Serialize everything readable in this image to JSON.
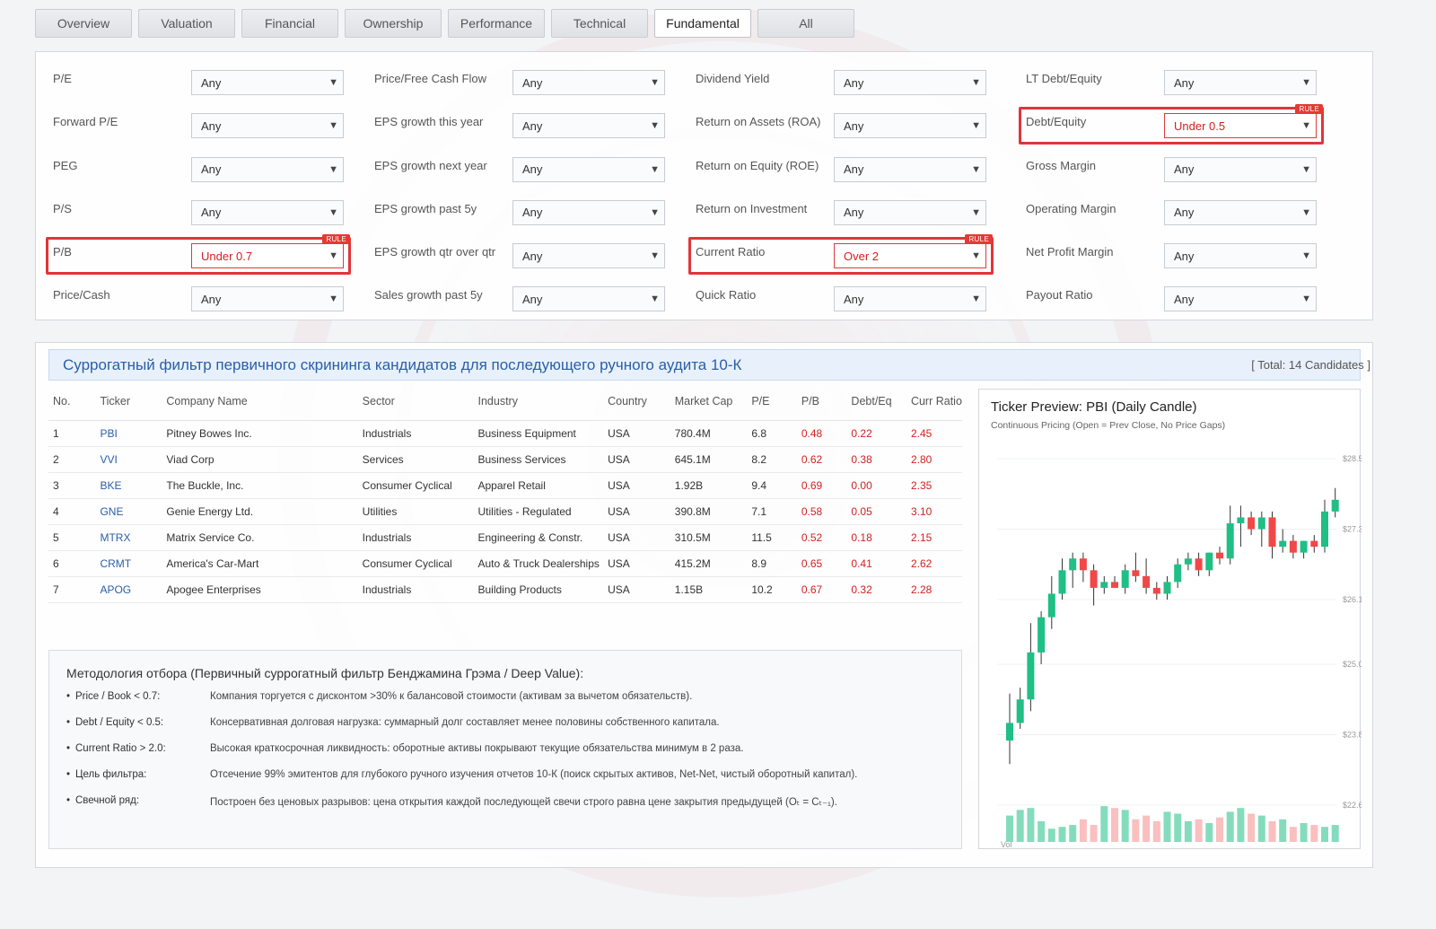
{
  "tabs": [
    "Overview",
    "Valuation",
    "Financial",
    "Ownership",
    "Performance",
    "Technical",
    "Fundamental",
    "All"
  ],
  "active_tab": "Fundamental",
  "filters": {
    "rule_badge": "RULE",
    "columns": [
      [
        {
          "label": "P/E",
          "value": "Any"
        },
        {
          "label": "Forward P/E",
          "value": "Any"
        },
        {
          "label": "PEG",
          "value": "Any"
        },
        {
          "label": "P/S",
          "value": "Any"
        },
        {
          "label": "P/B",
          "value": "Under 0.7",
          "rule": true
        },
        {
          "label": "Price/Cash",
          "value": "Any"
        }
      ],
      [
        {
          "label": "Price/Free Cash Flow",
          "value": "Any"
        },
        {
          "label": "EPS growth this year",
          "value": "Any"
        },
        {
          "label": "EPS growth next year",
          "value": "Any"
        },
        {
          "label": "EPS growth past 5y",
          "value": "Any"
        },
        {
          "label": "EPS growth qtr over qtr",
          "value": "Any"
        },
        {
          "label": "Sales growth past 5y",
          "value": "Any"
        }
      ],
      [
        {
          "label": "Dividend Yield",
          "value": "Any"
        },
        {
          "label": "Return on Assets (ROA)",
          "value": "Any"
        },
        {
          "label": "Return on Equity (ROE)",
          "value": "Any"
        },
        {
          "label": "Return on Investment",
          "value": "Any"
        },
        {
          "label": "Current Ratio",
          "value": "Over 2",
          "rule": true
        },
        {
          "label": "Quick Ratio",
          "value": "Any"
        }
      ],
      [
        {
          "label": "LT Debt/Equity",
          "value": "Any"
        },
        {
          "label": "Debt/Equity",
          "value": "Under 0.5",
          "rule": true
        },
        {
          "label": "Gross Margin",
          "value": "Any"
        },
        {
          "label": "Operating Margin",
          "value": "Any"
        },
        {
          "label": "Net Profit Margin",
          "value": "Any"
        },
        {
          "label": "Payout Ratio",
          "value": "Any"
        }
      ]
    ]
  },
  "results": {
    "title": "Суррогатный фильтр первичного скрининга кандидатов для последующего ручного аудита 10-К",
    "total": "[ Total: 14 Candidates ]",
    "columns": [
      "No.",
      "Ticker",
      "Company Name",
      "Sector",
      "Industry",
      "Country",
      "Market Cap",
      "P/E",
      "P/B",
      "Debt/Eq",
      "Curr Ratio"
    ],
    "rows": [
      [
        "1",
        "PBI",
        "Pitney Bowes Inc.",
        "Industrials",
        "Business Equipment",
        "USA",
        "780.4M",
        "6.8",
        "0.48",
        "0.22",
        "2.45"
      ],
      [
        "2",
        "VVI",
        "Viad Corp",
        "Services",
        "Business Services",
        "USA",
        "645.1M",
        "8.2",
        "0.62",
        "0.38",
        "2.80"
      ],
      [
        "3",
        "BKE",
        "The Buckle, Inc.",
        "Consumer Cyclical",
        "Apparel Retail",
        "USA",
        "1.92B",
        "9.4",
        "0.69",
        "0.00",
        "2.35"
      ],
      [
        "4",
        "GNE",
        "Genie Energy Ltd.",
        "Utilities",
        "Utilities - Regulated",
        "USA",
        "390.8M",
        "7.1",
        "0.58",
        "0.05",
        "3.10"
      ],
      [
        "5",
        "MTRX",
        "Matrix Service Co.",
        "Industrials",
        "Engineering & Constr.",
        "USA",
        "310.5M",
        "11.5",
        "0.52",
        "0.18",
        "2.15"
      ],
      [
        "6",
        "CRMT",
        "America's Car-Mart",
        "Consumer Cyclical",
        "Auto & Truck Dealerships",
        "USA",
        "415.2M",
        "8.9",
        "0.65",
        "0.41",
        "2.62"
      ],
      [
        "7",
        "APOG",
        "Apogee Enterprises",
        "Industrials",
        "Building Products",
        "USA",
        "1.15B",
        "10.2",
        "0.67",
        "0.32",
        "2.28"
      ]
    ]
  },
  "methodology": {
    "title": "Методология отбора (Первичный суррогатный фильтр Бенджамина Грэма / Deep Value):",
    "bullet": "•",
    "items": [
      {
        "key": "Price / Book < 0.7:",
        "text": "Компания торгуется с дисконтом >30% к балансовой стоимости (активам за вычетом обязательств)."
      },
      {
        "key": "Debt / Equity < 0.5:",
        "text": "Консервативная долговая нагрузка: суммарный долг составляет менее половины собственного капитала."
      },
      {
        "key": "Current Ratio > 2.0:",
        "text": "Высокая краткосрочная ликвидность: оборотные активы покрывают текущие обязательства минимум в 2 раза."
      },
      {
        "key": "Цель фильтра:",
        "text": "Отсечение 99% эмитентов для глубокого ручного изучения отчетов 10-К (поиск скрытых активов, Net-Net, чистый оборотный капитал)."
      },
      {
        "key": "Свечной ряд:",
        "text": "Построен без ценовых разрывов: цена открытия каждой последующей свечи строго равна цене закрытия предыдущей (Oₜ = Cₜ₋₁)."
      }
    ]
  },
  "chart_data": {
    "type": "candlestick",
    "title": "Ticker Preview: PBI (Daily Candle)",
    "subtitle": "Continuous Pricing (Open = Prev Close, No Price Gaps)",
    "volume_label": "Vol",
    "y_ticks": [
      "$28.5",
      "$27.3",
      "$26.1",
      "$25.0",
      "$23.8",
      "$22.6"
    ],
    "y_tick_values": [
      28.5,
      27.3,
      26.1,
      25.0,
      23.8,
      22.6
    ],
    "ylim": [
      22.6,
      28.5
    ],
    "up_color": "#1fbf86",
    "down_color": "#f04848",
    "candles": [
      {
        "o": 23.7,
        "h": 24.5,
        "l": 23.3,
        "c": 24.0
      },
      {
        "o": 24.0,
        "h": 24.6,
        "l": 23.9,
        "c": 24.4
      },
      {
        "o": 24.4,
        "h": 25.7,
        "l": 24.2,
        "c": 25.2
      },
      {
        "o": 25.2,
        "h": 25.9,
        "l": 25.0,
        "c": 25.8
      },
      {
        "o": 25.8,
        "h": 26.5,
        "l": 25.6,
        "c": 26.2
      },
      {
        "o": 26.2,
        "h": 26.8,
        "l": 26.1,
        "c": 26.6
      },
      {
        "o": 26.6,
        "h": 26.9,
        "l": 26.3,
        "c": 26.8
      },
      {
        "o": 26.8,
        "h": 26.9,
        "l": 26.4,
        "c": 26.6
      },
      {
        "o": 26.6,
        "h": 26.7,
        "l": 26.0,
        "c": 26.3
      },
      {
        "o": 26.3,
        "h": 26.5,
        "l": 26.2,
        "c": 26.4
      },
      {
        "o": 26.4,
        "h": 26.5,
        "l": 26.3,
        "c": 26.3
      },
      {
        "o": 26.3,
        "h": 26.7,
        "l": 26.2,
        "c": 26.6
      },
      {
        "o": 26.6,
        "h": 26.9,
        "l": 26.4,
        "c": 26.5
      },
      {
        "o": 26.5,
        "h": 26.8,
        "l": 26.2,
        "c": 26.3
      },
      {
        "o": 26.3,
        "h": 26.4,
        "l": 26.1,
        "c": 26.2
      },
      {
        "o": 26.2,
        "h": 26.5,
        "l": 26.1,
        "c": 26.4
      },
      {
        "o": 26.4,
        "h": 26.8,
        "l": 26.3,
        "c": 26.7
      },
      {
        "o": 26.7,
        "h": 26.9,
        "l": 26.6,
        "c": 26.8
      },
      {
        "o": 26.8,
        "h": 26.9,
        "l": 26.5,
        "c": 26.6
      },
      {
        "o": 26.6,
        "h": 26.9,
        "l": 26.5,
        "c": 26.9
      },
      {
        "o": 26.9,
        "h": 27.0,
        "l": 26.7,
        "c": 26.8
      },
      {
        "o": 26.8,
        "h": 27.7,
        "l": 26.7,
        "c": 27.4
      },
      {
        "o": 27.4,
        "h": 27.7,
        "l": 27.0,
        "c": 27.5
      },
      {
        "o": 27.5,
        "h": 27.6,
        "l": 27.2,
        "c": 27.3
      },
      {
        "o": 27.3,
        "h": 27.6,
        "l": 27.0,
        "c": 27.5
      },
      {
        "o": 27.5,
        "h": 27.6,
        "l": 26.8,
        "c": 27.0
      },
      {
        "o": 27.0,
        "h": 27.3,
        "l": 26.9,
        "c": 27.1
      },
      {
        "o": 27.1,
        "h": 27.2,
        "l": 26.8,
        "c": 26.9
      },
      {
        "o": 26.9,
        "h": 27.1,
        "l": 26.8,
        "c": 27.1
      },
      {
        "o": 27.1,
        "h": 27.2,
        "l": 26.9,
        "c": 27.0
      },
      {
        "o": 27.0,
        "h": 27.8,
        "l": 26.9,
        "c": 27.6
      },
      {
        "o": 27.6,
        "h": 28.0,
        "l": 27.5,
        "c": 27.8
      }
    ],
    "volume": [
      0.7,
      0.85,
      0.9,
      0.55,
      0.35,
      0.4,
      0.45,
      0.6,
      0.45,
      0.95,
      0.9,
      0.85,
      0.6,
      0.7,
      0.55,
      0.8,
      0.75,
      0.55,
      0.6,
      0.5,
      0.65,
      0.8,
      0.9,
      0.75,
      0.7,
      0.55,
      0.6,
      0.4,
      0.5,
      0.45,
      0.4,
      0.45
    ]
  }
}
